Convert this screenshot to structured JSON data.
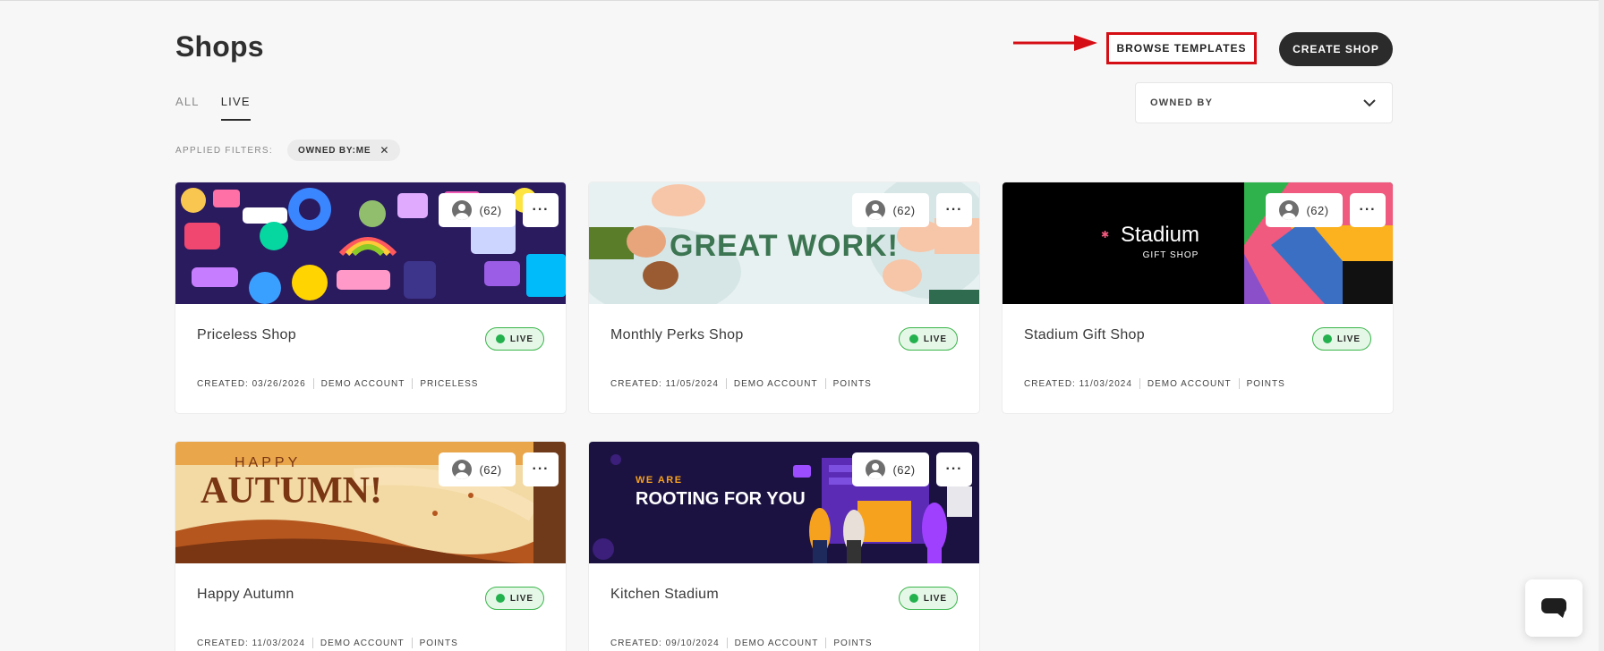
{
  "page": {
    "title": "Shops"
  },
  "header": {
    "browse_templates_label": "BROWSE TEMPLATES",
    "create_shop_label": "CREATE SHOP"
  },
  "tabs": [
    {
      "label": "ALL",
      "active": false
    },
    {
      "label": "LIVE",
      "active": true
    }
  ],
  "owned_by": {
    "label": "OWNED BY"
  },
  "filters": {
    "label": "APPLIED FILTERS:",
    "chips": [
      {
        "label": "OWNED BY:ME"
      }
    ]
  },
  "shops": [
    {
      "name": "Priceless Shop",
      "status": "LIVE",
      "owners": "(62)",
      "created": "CREATED: 03/26/2026",
      "account": "DEMO ACCOUNT",
      "currency": "PRICELESS",
      "banner": "stickers"
    },
    {
      "name": "Monthly Perks Shop",
      "status": "LIVE",
      "owners": "(62)",
      "created": "CREATED: 11/05/2024",
      "account": "DEMO ACCOUNT",
      "currency": "POINTS",
      "banner": "great-work",
      "banner_text": "GREAT WORK!"
    },
    {
      "name": "Stadium Gift Shop",
      "status": "LIVE",
      "owners": "(62)",
      "created": "CREATED: 11/03/2024",
      "account": "DEMO ACCOUNT",
      "currency": "POINTS",
      "banner": "stadium",
      "banner_text": "Stadium",
      "banner_subtext": "GIFT SHOP"
    },
    {
      "name": "Happy Autumn",
      "status": "LIVE",
      "owners": "(62)",
      "created": "CREATED: 11/03/2024",
      "account": "DEMO ACCOUNT",
      "currency": "POINTS",
      "banner": "autumn",
      "banner_text": "AUTUMN!",
      "banner_subtext": "HAPPY"
    },
    {
      "name": "Kitchen Stadium",
      "status": "LIVE",
      "owners": "(62)",
      "created": "CREATED: 09/10/2024",
      "account": "DEMO ACCOUNT",
      "currency": "POINTS",
      "banner": "rooting",
      "banner_text": "ROOTING FOR YOU",
      "banner_subtext": "WE ARE"
    }
  ],
  "colors": {
    "highlight": "#d40e14",
    "live_green": "#23b14d",
    "dark_button": "#2b2b2b"
  },
  "chat": {
    "icon": "chat-icon"
  }
}
